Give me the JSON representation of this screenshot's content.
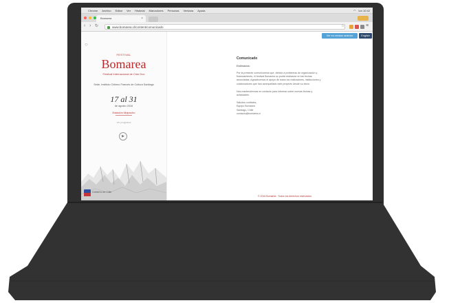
{
  "menubar": {
    "items": [
      "Chrome",
      "Archivo",
      "Editar",
      "Ver",
      "Historial",
      "Marcadores",
      "Personas",
      "Ventana",
      "Ayuda"
    ],
    "status": "lun 10:42"
  },
  "browser": {
    "tab_title": "Bomarea",
    "url": "www.bomarea.cl/content/comunicado",
    "colors": {
      "close": "#ff5f57",
      "minimize": "#ffbd2e",
      "zoom": "#28c840"
    }
  },
  "page": {
    "kicker": "FESTIVAL",
    "brand": "Bomarea",
    "tagline": "Festival Internacional de Cine Doc",
    "description": "Sede, Instituto Chileno Francés de Cultura Santiago",
    "dates": "17 al 31",
    "month": "de agosto 2016",
    "venue": "Estación Mapocho",
    "extra": "ver programa",
    "circle_icon": "▶",
    "btn_translate": "Ver en version anterior",
    "btn_lang": "English",
    "logo_text": "Gobierno de Chile",
    "content_title": "Comunicado",
    "greeting": "Estimados:",
    "paragraphs": [
      "Por la presente comunicamos que, debido a problemas de organización y financiamiento, el festival Bomarea no podrá realizarse en las fechas anunciadas. Agradecemos el apoyo de todos los realizadores, instituciones y colaboradores que han acompañado este proyecto desde su inicio.",
      "Nos mantendremos en contacto para informar sobre nuevas fechas y actividades."
    ],
    "signature": [
      "Saludos cordiales,",
      "Equipo Bomarea",
      "Santiago, Chile",
      "contacto@bomarea.cl"
    ],
    "footer": "© 2016 Bomarea · Todos los derechos reservados"
  }
}
